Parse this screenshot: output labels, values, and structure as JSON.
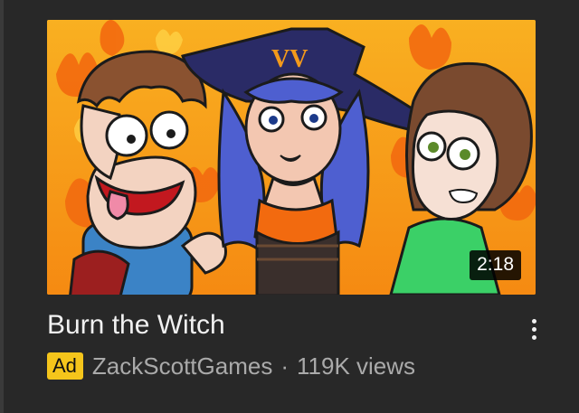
{
  "video": {
    "title": "Burn the Witch",
    "duration": "2:18",
    "ad_label": "Ad",
    "channel": "ZackScottGames",
    "separator": "·",
    "views": "119K views",
    "hat_text": "VV"
  },
  "icons": {
    "menu": "more-vert-icon"
  },
  "colors": {
    "background": "#282828",
    "title": "#f1f1f1",
    "meta": "#aaaaaa",
    "ad_badge": "#f5c51b",
    "thumb_bg": "#f7a21c"
  }
}
